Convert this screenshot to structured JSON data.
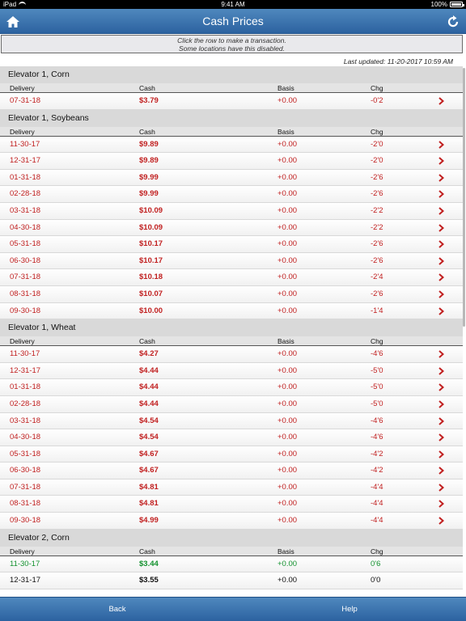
{
  "status_bar": {
    "device": "iPad",
    "time": "9:41 AM",
    "battery": "100%"
  },
  "navbar": {
    "title": "Cash Prices"
  },
  "instructions": {
    "line1": "Click the row to make a transaction.",
    "line2": "Some locations have this disabled."
  },
  "last_updated": "Last updated: 11-20-2017 10:59 AM",
  "columns": {
    "delivery": "Delivery",
    "cash": "Cash",
    "basis": "Basis",
    "chg": "Chg"
  },
  "colors": {
    "red": "#c12020",
    "green": "#13912e",
    "black": "#111111"
  },
  "groups": [
    {
      "name": "Elevator 1, Corn",
      "rows": [
        {
          "delivery": "07-31-18",
          "cash": "$3.79",
          "basis": "+0.00",
          "chg": "-0'2",
          "trend": "red"
        }
      ]
    },
    {
      "name": "Elevator 1, Soybeans",
      "rows": [
        {
          "delivery": "11-30-17",
          "cash": "$9.89",
          "basis": "+0.00",
          "chg": "-2'0",
          "trend": "red"
        },
        {
          "delivery": "12-31-17",
          "cash": "$9.89",
          "basis": "+0.00",
          "chg": "-2'0",
          "trend": "red"
        },
        {
          "delivery": "01-31-18",
          "cash": "$9.99",
          "basis": "+0.00",
          "chg": "-2'6",
          "trend": "red"
        },
        {
          "delivery": "02-28-18",
          "cash": "$9.99",
          "basis": "+0.00",
          "chg": "-2'6",
          "trend": "red"
        },
        {
          "delivery": "03-31-18",
          "cash": "$10.09",
          "basis": "+0.00",
          "chg": "-2'2",
          "trend": "red"
        },
        {
          "delivery": "04-30-18",
          "cash": "$10.09",
          "basis": "+0.00",
          "chg": "-2'2",
          "trend": "red"
        },
        {
          "delivery": "05-31-18",
          "cash": "$10.17",
          "basis": "+0.00",
          "chg": "-2'6",
          "trend": "red"
        },
        {
          "delivery": "06-30-18",
          "cash": "$10.17",
          "basis": "+0.00",
          "chg": "-2'6",
          "trend": "red"
        },
        {
          "delivery": "07-31-18",
          "cash": "$10.18",
          "basis": "+0.00",
          "chg": "-2'4",
          "trend": "red"
        },
        {
          "delivery": "08-31-18",
          "cash": "$10.07",
          "basis": "+0.00",
          "chg": "-2'6",
          "trend": "red"
        },
        {
          "delivery": "09-30-18",
          "cash": "$10.00",
          "basis": "+0.00",
          "chg": "-1'4",
          "trend": "red"
        }
      ]
    },
    {
      "name": "Elevator 1, Wheat",
      "rows": [
        {
          "delivery": "11-30-17",
          "cash": "$4.27",
          "basis": "+0.00",
          "chg": "-4'6",
          "trend": "red"
        },
        {
          "delivery": "12-31-17",
          "cash": "$4.44",
          "basis": "+0.00",
          "chg": "-5'0",
          "trend": "red"
        },
        {
          "delivery": "01-31-18",
          "cash": "$4.44",
          "basis": "+0.00",
          "chg": "-5'0",
          "trend": "red"
        },
        {
          "delivery": "02-28-18",
          "cash": "$4.44",
          "basis": "+0.00",
          "chg": "-5'0",
          "trend": "red"
        },
        {
          "delivery": "03-31-18",
          "cash": "$4.54",
          "basis": "+0.00",
          "chg": "-4'6",
          "trend": "red"
        },
        {
          "delivery": "04-30-18",
          "cash": "$4.54",
          "basis": "+0.00",
          "chg": "-4'6",
          "trend": "red"
        },
        {
          "delivery": "05-31-18",
          "cash": "$4.67",
          "basis": "+0.00",
          "chg": "-4'2",
          "trend": "red"
        },
        {
          "delivery": "06-30-18",
          "cash": "$4.67",
          "basis": "+0.00",
          "chg": "-4'2",
          "trend": "red"
        },
        {
          "delivery": "07-31-18",
          "cash": "$4.81",
          "basis": "+0.00",
          "chg": "-4'4",
          "trend": "red"
        },
        {
          "delivery": "08-31-18",
          "cash": "$4.81",
          "basis": "+0.00",
          "chg": "-4'4",
          "trend": "red"
        },
        {
          "delivery": "09-30-18",
          "cash": "$4.99",
          "basis": "+0.00",
          "chg": "-4'4",
          "trend": "red"
        }
      ]
    },
    {
      "name": "Elevator 2, Corn",
      "rows": [
        {
          "delivery": "11-30-17",
          "cash": "$3.44",
          "basis": "+0.00",
          "chg": "0'6",
          "trend": "green"
        },
        {
          "delivery": "12-31-17",
          "cash": "$3.55",
          "basis": "+0.00",
          "chg": "0'0",
          "trend": "black"
        }
      ]
    }
  ],
  "toolbar": {
    "back_label": "Back",
    "help_label": "Help"
  }
}
